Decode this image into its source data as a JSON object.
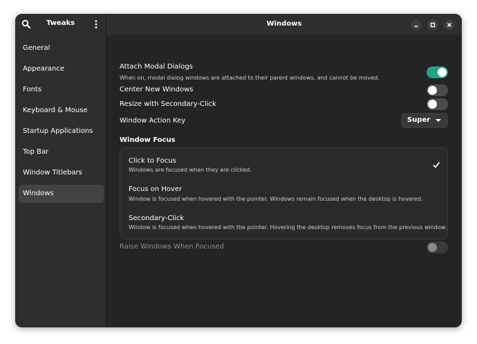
{
  "app": {
    "title": "Tweaks",
    "page_title": "Windows"
  },
  "sidebar": {
    "items": [
      {
        "label": "General"
      },
      {
        "label": "Appearance"
      },
      {
        "label": "Fonts"
      },
      {
        "label": "Keyboard & Mouse"
      },
      {
        "label": "Startup Applications"
      },
      {
        "label": "Top Bar"
      },
      {
        "label": "Window Titlebars"
      },
      {
        "label": "Windows",
        "active": true
      }
    ]
  },
  "settings": {
    "attach_modal": {
      "label": "Attach Modal Dialogs",
      "description": "When on, modal dialog windows are attached to their parent windows, and cannot be moved.",
      "state": "on"
    },
    "center_new": {
      "label": "Center New Windows",
      "state": "off"
    },
    "resize_secondary": {
      "label": "Resize with Secondary-Click",
      "state": "off"
    },
    "action_key": {
      "label": "Window Action Key",
      "value": "Super"
    },
    "window_focus": {
      "title": "Window Focus",
      "options": [
        {
          "label": "Click to Focus",
          "description": "Windows are focused when they are clicked.",
          "selected": true
        },
        {
          "label": "Focus on Hover",
          "description": "Window is focused when hovered with the pointer. Windows remain focused when the desktop is hovered."
        },
        {
          "label": "Secondary-Click",
          "description": "Window is focused when hovered with the pointer. Hovering the desktop removes focus from the previous window."
        }
      ]
    },
    "raise_focused": {
      "label": "Raise Windows When Focused",
      "state": "off",
      "disabled": true
    }
  },
  "colors": {
    "accent": "#26a189",
    "window_bg": "#242424",
    "sidebar_bg": "#2e2e2e"
  },
  "icons": {
    "search": "search-icon",
    "menu": "vertical-dots-icon",
    "minimize": "minimize-icon",
    "maximize": "maximize-icon",
    "close": "close-icon",
    "check": "checkmark-icon"
  }
}
